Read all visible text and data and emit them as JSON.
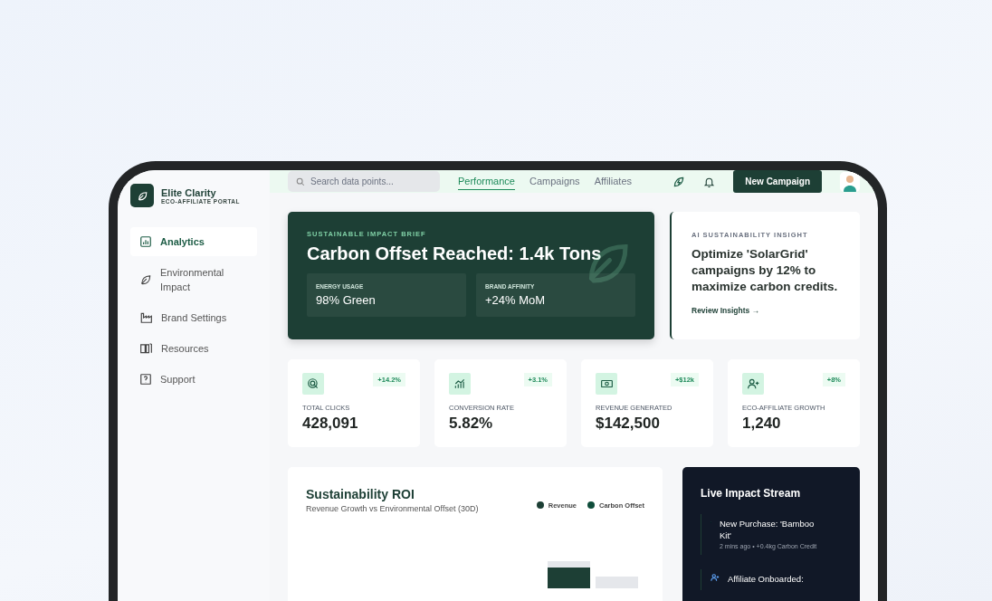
{
  "brand": {
    "name": "Elite Clarity",
    "tagline": "ECO-AFFILIATE PORTAL"
  },
  "sidebar": {
    "items": [
      {
        "label": "Analytics",
        "selected": true
      },
      {
        "label": "Environmental Impact",
        "selected": false
      },
      {
        "label": "Brand Settings",
        "selected": false
      },
      {
        "label": "Resources",
        "selected": false
      },
      {
        "label": "Support",
        "selected": false
      }
    ]
  },
  "topbar": {
    "search": {
      "placeholder": "Search data points..."
    },
    "tabs": [
      {
        "label": "Performance",
        "selected": true
      },
      {
        "label": "Campaigns",
        "selected": false
      },
      {
        "label": "Affiliates",
        "selected": false
      }
    ],
    "button": "New Campaign"
  },
  "hero": {
    "eyebrow": "SUSTAINABLE IMPACT BRIEF",
    "title": "Carbon Offset Reached: 1.4k Tons",
    "metrics": [
      {
        "label": "ENERGY USAGE",
        "value": "98% Green"
      },
      {
        "label": "BRAND AFFINITY",
        "value": "+24% MoM"
      }
    ]
  },
  "insight": {
    "eyebrow": "AI SUSTAINABILITY INSIGHT",
    "text": "Optimize 'SolarGrid' campaigns by 12% to maximize carbon credits.",
    "link": "Review Insights →"
  },
  "stats": [
    {
      "label": "TOTAL CLICKS",
      "value": "428,091",
      "change": "+14.2%"
    },
    {
      "label": "CONVERSION RATE",
      "value": "5.82%",
      "change": "+3.1%"
    },
    {
      "label": "REVENUE GENERATED",
      "value": "$142,500",
      "change": "+$12k"
    },
    {
      "label": "ECO-AFFILIATE GROWTH",
      "value": "1,240",
      "change": "+8%"
    }
  ],
  "roi": {
    "title": "Sustainability ROI",
    "subtitle": "Revenue Growth vs Environmental Offset (30D)",
    "legend": [
      {
        "label": "Revenue",
        "color": "#1d3f35"
      },
      {
        "label": "Carbon Offset",
        "color": "#0f4d3a"
      }
    ]
  },
  "stream": {
    "title": "Live Impact Stream",
    "events": [
      {
        "title": "New Purchase: 'Bamboo Kit'",
        "meta": "2 mins ago • +0.4kg Carbon Credit"
      },
      {
        "title": "Affiliate Onboarded:"
      }
    ]
  }
}
